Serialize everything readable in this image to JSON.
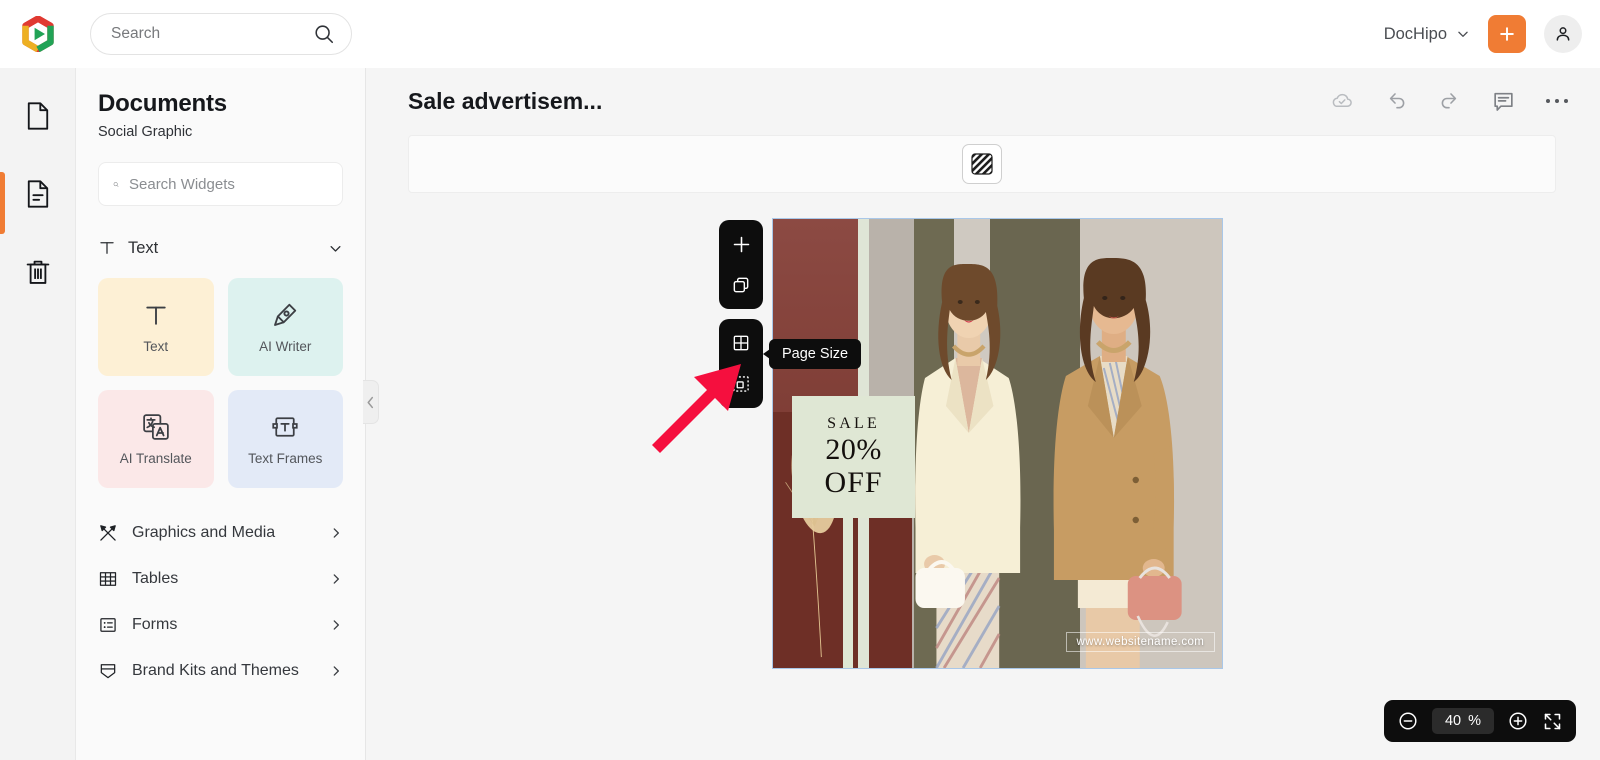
{
  "topbar": {
    "logo_icon": "dochipo-hexagon-logo",
    "search_placeholder": "Search",
    "search_value": "",
    "search_icon": "search-icon",
    "brand_label": "DocHipo",
    "brand_caret_icon": "chevron-down-icon",
    "create_icon": "plus-icon",
    "account_icon": "user-avatar-icon"
  },
  "rail": {
    "items": [
      {
        "icon": "blank-page-icon",
        "name": "pages",
        "active": false
      },
      {
        "icon": "document-lines-icon",
        "name": "documents",
        "active": true
      },
      {
        "icon": "trash-icon",
        "name": "trash",
        "active": false
      }
    ]
  },
  "panel": {
    "title": "Documents",
    "subtitle": "Social Graphic",
    "search_placeholder": "Search Widgets",
    "search_value": "",
    "search_icon": "search-icon",
    "section": {
      "label": "Text",
      "icon": "text-t-icon",
      "chevron": "chevron-down-icon",
      "expanded": true
    },
    "cards": [
      {
        "label": "Text",
        "icon": "text-t-icon",
        "bg": "#fdf0d5"
      },
      {
        "label": "AI Writer",
        "icon": "pen-nib-icon",
        "bg": "#ddf2ef"
      },
      {
        "label": "AI Translate",
        "icon": "translate-icon",
        "bg": "#fbe8e8"
      },
      {
        "label": "Text Frames",
        "icon": "text-frame-icon",
        "bg": "#e3eaf7"
      }
    ],
    "menu": [
      {
        "label": "Graphics and Media",
        "icon": "shapes-media-icon",
        "chevron": "chevron-right-icon"
      },
      {
        "label": "Tables",
        "icon": "table-grid-icon",
        "chevron": "chevron-right-icon"
      },
      {
        "label": "Forms",
        "icon": "form-icon",
        "chevron": "chevron-right-icon"
      },
      {
        "label": "Brand Kits and Themes",
        "icon": "brand-kit-icon",
        "chevron": "chevron-right-icon"
      }
    ],
    "collapse_icon": "chevron-left-icon"
  },
  "editor": {
    "document_title": "Sale advertisem...",
    "actions": [
      {
        "name": "cloud-saved",
        "icon": "cloud-check-icon"
      },
      {
        "name": "undo",
        "icon": "undo-arrow-icon"
      },
      {
        "name": "redo",
        "icon": "redo-arrow-icon"
      },
      {
        "name": "comments",
        "icon": "comment-icon"
      },
      {
        "name": "more-options",
        "icon": "ellipsis-icon"
      }
    ],
    "background_toolbar": {
      "pattern_icon": "diagonal-stripes-pattern-icon"
    },
    "page_tools": {
      "group_one": [
        {
          "name": "add-page",
          "icon": "plus-icon"
        },
        {
          "name": "duplicate-page",
          "icon": "copy-pages-icon"
        }
      ],
      "group_two": [
        {
          "name": "page-grid",
          "icon": "grid-layout-icon"
        },
        {
          "name": "page-size",
          "icon": "page-size-dashed-icon",
          "selected": true
        }
      ],
      "tooltip": "Page Size"
    },
    "pointer": {
      "icon": "red-arrow-pointer",
      "color": "#f50f3e"
    },
    "zoom": {
      "decrease_icon": "minus-circle-icon",
      "value": "40",
      "unit": "%",
      "increase_icon": "plus-circle-icon",
      "fullscreen_icon": "expand-fullscreen-icon"
    }
  },
  "artboard": {
    "sale_label": "SALE",
    "discount": "20%",
    "off_label": "OFF",
    "website": "www.websitename.com",
    "palette": {
      "rust": "#7c3b33",
      "deep_rust": "#6e2f26",
      "mint": "#dfe7d4",
      "olive": "#6a6650",
      "stone": "#cdc6bd",
      "cream": "#f3ecd9",
      "tan": "#c39b63",
      "blush": "#d98e7d"
    }
  }
}
